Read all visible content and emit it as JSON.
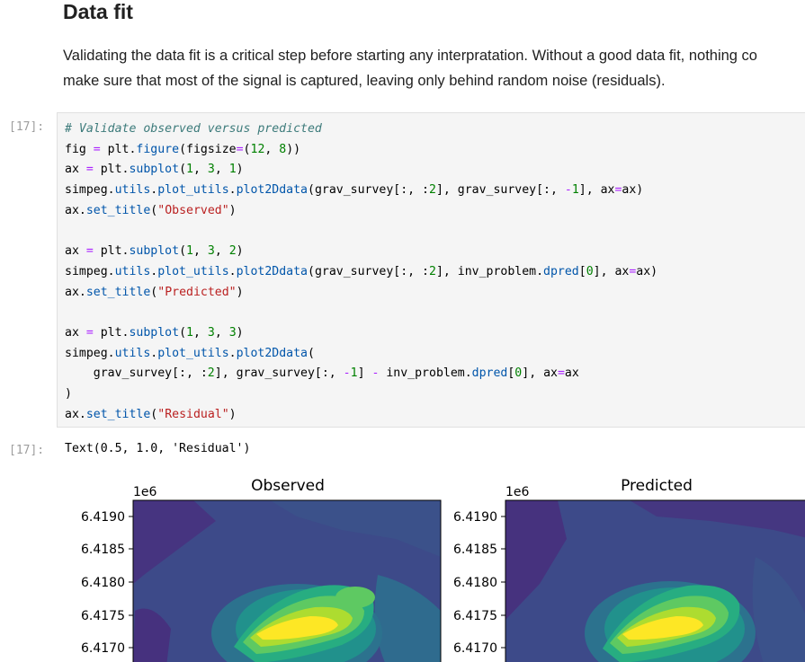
{
  "markdown": {
    "heading": "Data fit",
    "line1": "Validating the data fit is a critical step before starting any interpratation. Without a good data fit, nothing co",
    "line2": "make sure that most of the signal is captured, leaving only behind random noise (residuals)."
  },
  "cell": {
    "in_prompt": "[17]:",
    "out_prompt": "[17]:",
    "code_lines": [
      "# Validate observed versus predicted",
      "fig = plt.figure(figsize=(12, 8))",
      "ax = plt.subplot(1, 3, 1)",
      "simpeg.utils.plot_utils.plot2Ddata(grav_survey[:, :2], grav_survey[:, -1], ax=ax)",
      "ax.set_title(\"Observed\")",
      "",
      "ax = plt.subplot(1, 3, 2)",
      "simpeg.utils.plot_utils.plot2Ddata(grav_survey[:, :2], inv_problem.dpred[0], ax=ax)",
      "ax.set_title(\"Predicted\")",
      "",
      "ax = plt.subplot(1, 3, 3)",
      "simpeg.utils.plot_utils.plot2Ddata(",
      "    grav_survey[:, :2], grav_survey[:, -1] - inv_problem.dpred[0], ax=ax",
      ")",
      "ax.set_title(\"Residual\")"
    ],
    "output_text": "Text(0.5, 1.0, 'Residual')"
  },
  "chart_data": [
    {
      "type": "heatmap",
      "title": "Observed",
      "y_offset_label": "1e6",
      "yticks": [
        "6.4190",
        "6.4185",
        "6.4180",
        "6.4175",
        "6.4170"
      ],
      "colormap": "viridis"
    },
    {
      "type": "heatmap",
      "title": "Predicted",
      "y_offset_label": "1e6",
      "yticks": [
        "6.4190",
        "6.4185",
        "6.4180",
        "6.4175",
        "6.4170"
      ],
      "colormap": "viridis"
    }
  ],
  "colors": {
    "comment": "#3d7b7b",
    "keyword": "#008000",
    "operator": "#aa22ff",
    "attribute": "#0055aa",
    "string": "#ba2121",
    "number": "#008000",
    "prompt": "#9e9e9e",
    "cell_bg": "#f5f5f5"
  }
}
